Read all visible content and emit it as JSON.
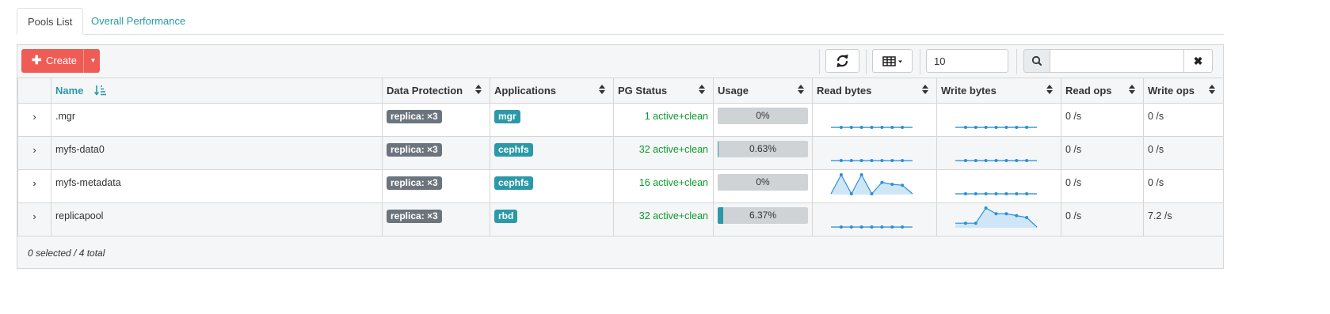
{
  "tabs": [
    {
      "label": "Pools List",
      "active": true
    },
    {
      "label": "Overall Performance",
      "active": false
    }
  ],
  "toolbar": {
    "create_label": "Create",
    "page_size": "10",
    "search_placeholder": "",
    "icons": {
      "create": "plus-icon",
      "refresh": "refresh-icon",
      "columns": "table-columns-icon",
      "search": "search-icon",
      "clear": "close-icon"
    }
  },
  "table": {
    "columns": [
      "Name",
      "Data Protection",
      "Applications",
      "PG Status",
      "Usage",
      "Read bytes",
      "Write bytes",
      "Read ops",
      "Write ops"
    ],
    "rows": [
      {
        "name": ".mgr",
        "data_protection": "replica: ×3",
        "application": "mgr",
        "pg_status": "1 active+clean",
        "usage_text": "0%",
        "usage_pct": 0,
        "read_bytes": [
          0,
          0,
          0,
          0,
          0,
          0,
          0,
          0,
          0
        ],
        "write_bytes": [
          0,
          0,
          0,
          0,
          0,
          0,
          0,
          0,
          0
        ],
        "read_ops": "0 /s",
        "write_ops": "0 /s"
      },
      {
        "name": "myfs-data0",
        "data_protection": "replica: ×3",
        "application": "cephfs",
        "pg_status": "32 active+clean",
        "usage_text": "0.63%",
        "usage_pct": 0.63,
        "read_bytes": [
          0,
          0,
          0,
          0,
          0,
          0,
          0,
          0,
          0
        ],
        "write_bytes": [
          0,
          0,
          0,
          0,
          0,
          0,
          0,
          0,
          0
        ],
        "read_ops": "0 /s",
        "write_ops": "0 /s"
      },
      {
        "name": "myfs-metadata",
        "data_protection": "replica: ×3",
        "application": "cephfs",
        "pg_status": "16 active+clean",
        "usage_text": "0%",
        "usage_pct": 0,
        "read_bytes": [
          0,
          1,
          0,
          1,
          0,
          0.6,
          0.5,
          0.45,
          0
        ],
        "write_bytes": [
          0,
          0,
          0,
          0,
          0,
          0,
          0,
          0,
          0
        ],
        "read_ops": "0 /s",
        "write_ops": "0 /s"
      },
      {
        "name": "replicapool",
        "data_protection": "replica: ×3",
        "application": "rbd",
        "pg_status": "32 active+clean",
        "usage_text": "6.37%",
        "usage_pct": 6.37,
        "read_bytes": [
          0,
          0,
          0,
          0,
          0,
          0,
          0,
          0,
          0
        ],
        "write_bytes": [
          0.2,
          0.2,
          0.2,
          1,
          0.7,
          0.7,
          0.6,
          0.5,
          0
        ],
        "read_ops": "0 /s",
        "write_ops": "7.2 /s"
      }
    ]
  },
  "footer": {
    "selection_text": "0 selected / 4 total"
  },
  "colors": {
    "accent": "#2b99a8",
    "create_button": "#ef5c55",
    "pg_ok": "#0b9a2c",
    "badge_gray": "#6c757d",
    "spark_line": "#2a8fd8",
    "spark_fill": "#cfe6f7"
  }
}
